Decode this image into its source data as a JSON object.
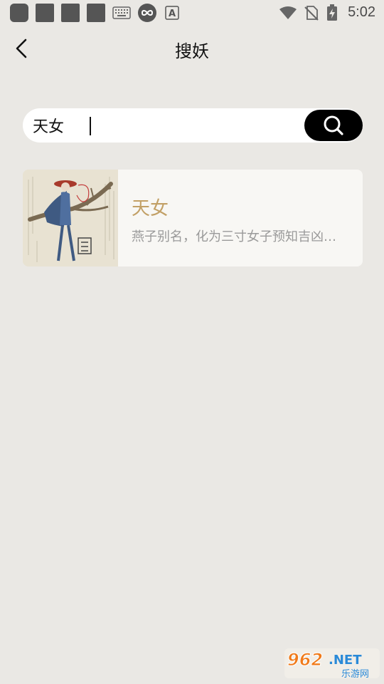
{
  "status_bar": {
    "time": "5:02",
    "notification_icons": [
      "app-icon",
      "app-icon",
      "app-icon",
      "app-icon",
      "keyboard-icon",
      "infinity-icon",
      "font-a-icon"
    ],
    "system_icons": [
      "wifi-icon",
      "no-sim-icon",
      "battery-charging-icon"
    ]
  },
  "header": {
    "title": "搜妖",
    "back_icon": "chevron-left-icon"
  },
  "search": {
    "value": "天女",
    "button_icon": "search-icon",
    "button_color": "#000000"
  },
  "results": [
    {
      "title": "天女",
      "description": "燕子别名，化为三寸女子预知吉凶…",
      "title_color": "#c2a066",
      "thumbnail": "illustration-thumbnail"
    }
  ],
  "watermark": {
    "brand": "962.NET",
    "subtitle": "乐游网"
  },
  "colors": {
    "background": "#eae8e4",
    "card": "#f8f7f4"
  }
}
